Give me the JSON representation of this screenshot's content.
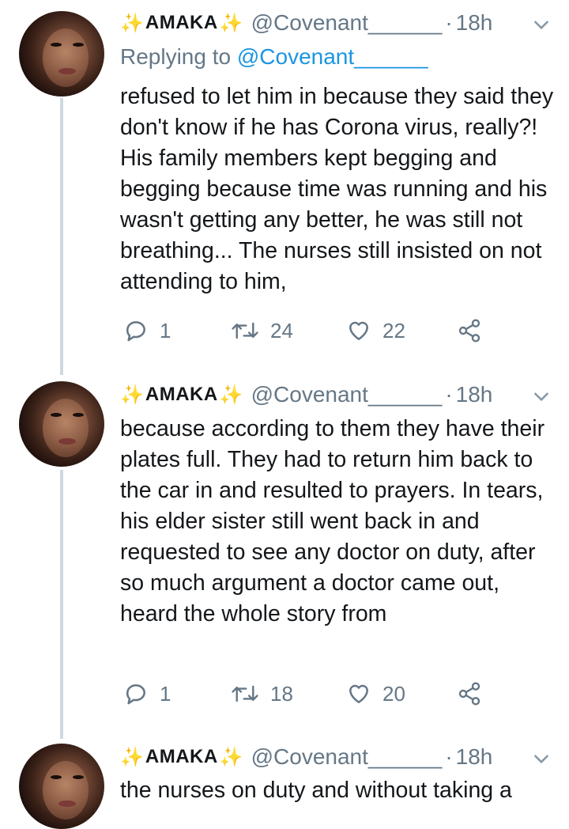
{
  "colors": {
    "accent": "#1b95e0",
    "muted": "#657786",
    "sparkle": "#f5b800"
  },
  "tweets": [
    {
      "name": "Amaka",
      "handle": "@Covenant______",
      "time": "18h",
      "replying_prefix": "Replying to ",
      "replying_handle": "@Covenant______",
      "text": "refused to let him in because they said they don't know if he has Corona virus, really?! His family members kept begging and begging because time was running and his wasn't getting any better, he was still not breathing... The nurses still insisted on not attending to him,",
      "replies": "1",
      "retweets": "24",
      "likes": "22"
    },
    {
      "name": "Amaka",
      "handle": "@Covenant______",
      "time": "18h",
      "text": "because according to them they have their plates full. They had to return him back to the car in and resulted to prayers. In tears, his elder sister still went back in and requested to see any doctor on duty, after so much argument a doctor came out, heard the whole story from",
      "replies": "1",
      "retweets": "18",
      "likes": "20"
    },
    {
      "name": "Amaka",
      "handle": "@Covenant______",
      "time": "18h",
      "text": "the nurses on duty and without taking a"
    }
  ]
}
